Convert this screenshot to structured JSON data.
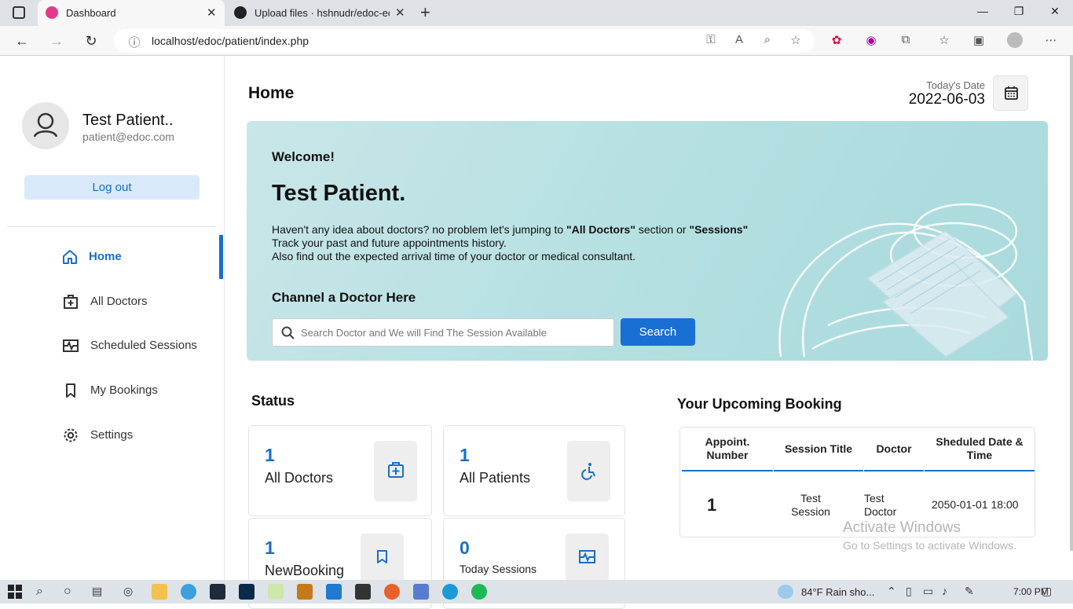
{
  "browser": {
    "tabs": [
      {
        "title": "Dashboard",
        "active": true
      },
      {
        "title": "Upload files · hshnudr/edoc-echa",
        "active": false
      }
    ],
    "url": "localhost/edoc/patient/index.php"
  },
  "sidebar": {
    "profile_name": "Test Patient..",
    "profile_email": "patient@edoc.com",
    "logout_label": "Log out",
    "items": [
      {
        "label": "Home",
        "icon": "home-icon",
        "active": true
      },
      {
        "label": "All Doctors",
        "icon": "doctor-add-icon",
        "active": false
      },
      {
        "label": "Scheduled Sessions",
        "icon": "pulse-icon",
        "active": false
      },
      {
        "label": "My Bookings",
        "icon": "bookmark-icon",
        "active": false
      },
      {
        "label": "Settings",
        "icon": "gear-icon",
        "active": false
      }
    ]
  },
  "header": {
    "title": "Home",
    "date_label": "Today's Date",
    "date_value": "2022-06-03"
  },
  "welcome": {
    "greeting": "Welcome!",
    "name": "Test Patient.",
    "line1_prefix": "Haven't any idea about doctors? no problem let's jumping to ",
    "line1_bold1": "\"All Doctors\"",
    "line1_middle": " section or ",
    "line1_bold2": "\"Sessions\"",
    "line2": "Track your past and future appointments history.",
    "line3": "Also find out the expected arrival time of your doctor or medical consultant.",
    "channel_title": "Channel a Doctor Here",
    "search_placeholder": "Search Doctor and We will Find The Session Available",
    "search_button": "Search"
  },
  "status": {
    "title": "Status",
    "cards": [
      {
        "value": "1",
        "label": "All Doctors"
      },
      {
        "value": "1",
        "label": "All Patients"
      },
      {
        "value": "1",
        "label": "NewBooking"
      },
      {
        "value": "0",
        "label": "Today Sessions"
      }
    ]
  },
  "booking": {
    "title": "Your Upcoming Booking",
    "columns": [
      "Appoint. Number",
      "Session Title",
      "Doctor",
      "Sheduled Date & Time"
    ],
    "rows": [
      {
        "number": "1",
        "session": "Test Session",
        "doctor": "Test Doctor",
        "datetime": "2050-01-01 18:00"
      }
    ]
  },
  "watermark": {
    "title": "Activate Windows",
    "subtitle": "Go to Settings to activate Windows."
  },
  "taskbar": {
    "weather": "84°F  Rain sho...",
    "time": "7:00 PM"
  },
  "colors": {
    "accent": "#1a6fc4",
    "button": "#1a6fd4",
    "logout_bg": "#d8e9fa",
    "banner": "#b3dfe1"
  }
}
